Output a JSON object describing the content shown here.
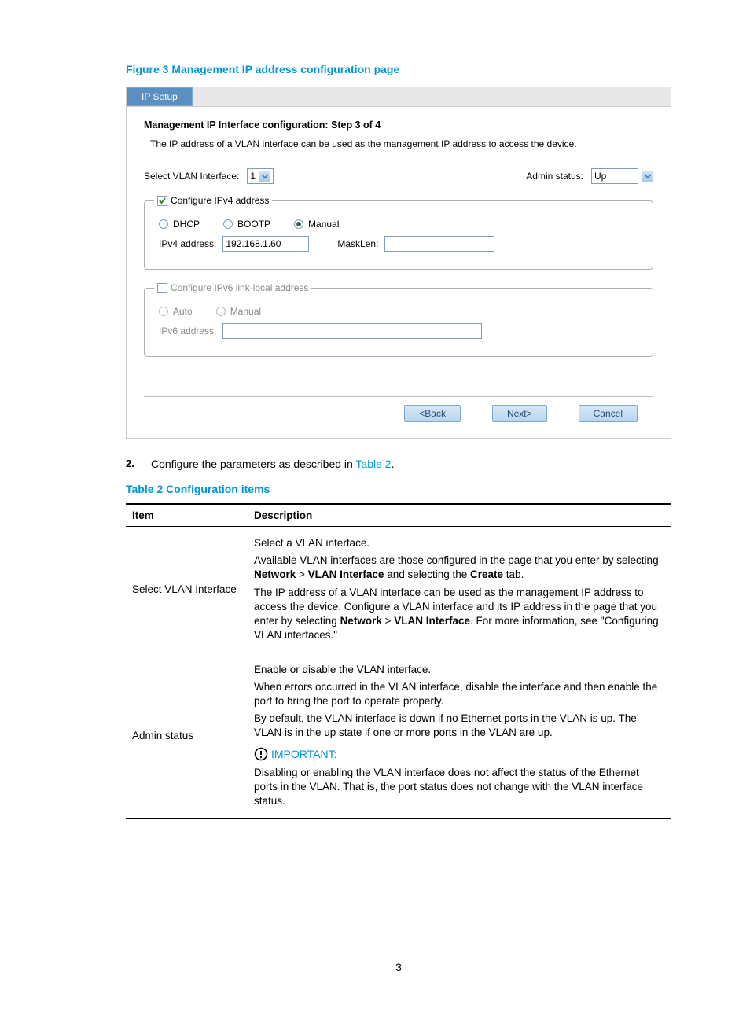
{
  "figure_title": "Figure 3 Management IP address configuration page",
  "tab_label": "IP Setup",
  "step_header": "Management IP Interface configuration:  Step 3 of 4",
  "info_text": "The IP address of a VLAN interface can be used as the management IP address to access the device.",
  "vlan_label": "Select VLAN Interface:",
  "vlan_value": "1",
  "admin_label": "Admin status:",
  "admin_value": "Up",
  "ipv4_legend": "Configure IPv4 address",
  "ipv4_opts": {
    "dhcp": "DHCP",
    "bootp": "BOOTP",
    "manual": "Manual"
  },
  "ipv4_addr_label": "IPv4 address:",
  "ipv4_addr_value": "192.168.1.60",
  "masklen_label": "MaskLen:",
  "masklen_value": "",
  "ipv6_legend": "Configure IPv6 link-local address",
  "ipv6_opts": {
    "auto": "Auto",
    "manual": "Manual"
  },
  "ipv6_addr_label": "IPv6 address:",
  "ipv6_addr_value": "",
  "buttons": {
    "back": "<Back",
    "next": "Next>",
    "cancel": "Cancel"
  },
  "instruction_num": "2.",
  "instruction_text_pre": "Configure the parameters as described in ",
  "instruction_link": "Table 2",
  "instruction_text_post": ".",
  "table_title": "Table 2 Configuration items",
  "table_headers": {
    "item": "Item",
    "desc": "Description"
  },
  "row1_item": "Select VLAN Interface",
  "row1_p1": "Select a VLAN interface.",
  "row1_p2a": "Available VLAN interfaces are those configured in the page that you enter by selecting ",
  "row1_p2b": "Network",
  "row1_p2c": " > ",
  "row1_p2d": "VLAN Interface",
  "row1_p2e": " and selecting the ",
  "row1_p2f": "Create",
  "row1_p2g": " tab.",
  "row1_p3a": "The IP address of a VLAN interface can be used as the management IP address to access the device. Configure a VLAN interface and its IP address in the page that you enter by selecting ",
  "row1_p3b": "Network",
  "row1_p3c": " > ",
  "row1_p3d": "VLAN Interface",
  "row1_p3e": ". For more information, see \"Configuring VLAN interfaces.\"",
  "row2_item": "Admin status",
  "row2_p1": "Enable or disable the VLAN interface.",
  "row2_p2": "When errors occurred in the VLAN interface, disable the interface and then enable the port to bring the port to operate properly.",
  "row2_p3": "By default, the VLAN interface is down if no Ethernet ports in the VLAN is up. The VLAN is in the up state if one or more ports in the VLAN are up.",
  "important_label": "IMPORTANT:",
  "row2_p4": "Disabling or enabling the VLAN interface does not affect the status of the Ethernet ports in the VLAN. That is, the port status does not change with the VLAN interface status.",
  "page_number": "3"
}
